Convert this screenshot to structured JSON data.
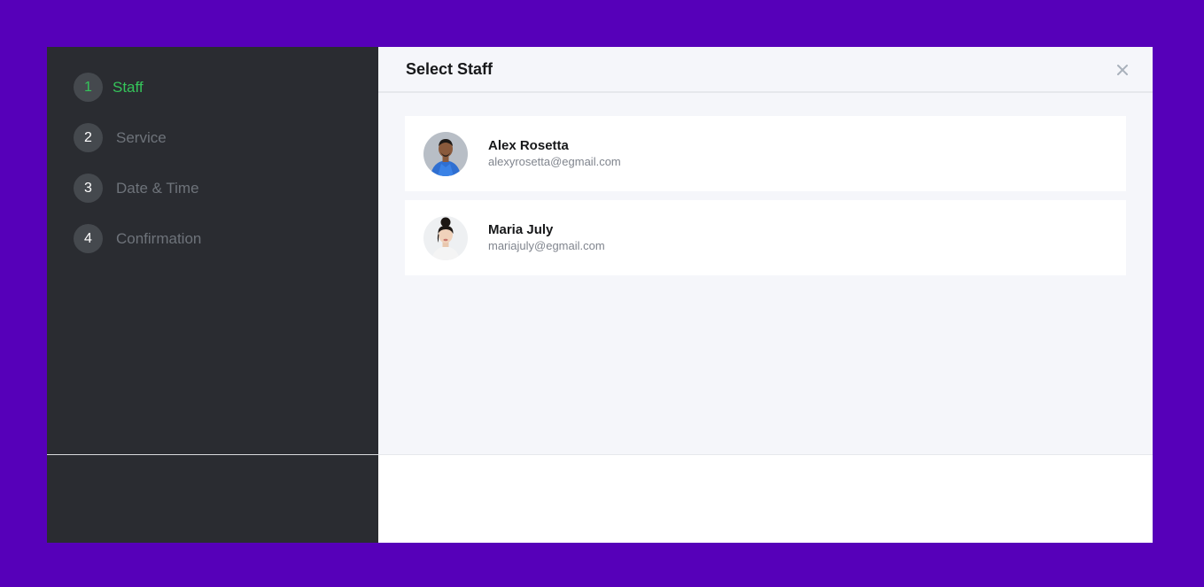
{
  "colors": {
    "page_background": "#5600b9",
    "sidebar_background": "#2a2c31",
    "active_step": "#35c45a",
    "inactive_step": "#6e737a",
    "main_background": "#f5f6fa"
  },
  "steps": [
    {
      "number": "1",
      "label": "Staff",
      "active": true
    },
    {
      "number": "2",
      "label": "Service",
      "active": false
    },
    {
      "number": "3",
      "label": "Date & Time",
      "active": false
    },
    {
      "number": "4",
      "label": "Confirmation",
      "active": false
    }
  ],
  "header": {
    "title": "Select Staff",
    "close_icon": "close-icon"
  },
  "staff": [
    {
      "name": "Alex Rosetta",
      "email": "alexyrosetta@egmail.com",
      "avatar_icon": "avatar-male"
    },
    {
      "name": "Maria July",
      "email": "mariajuly@egmail.com",
      "avatar_icon": "avatar-female"
    }
  ]
}
